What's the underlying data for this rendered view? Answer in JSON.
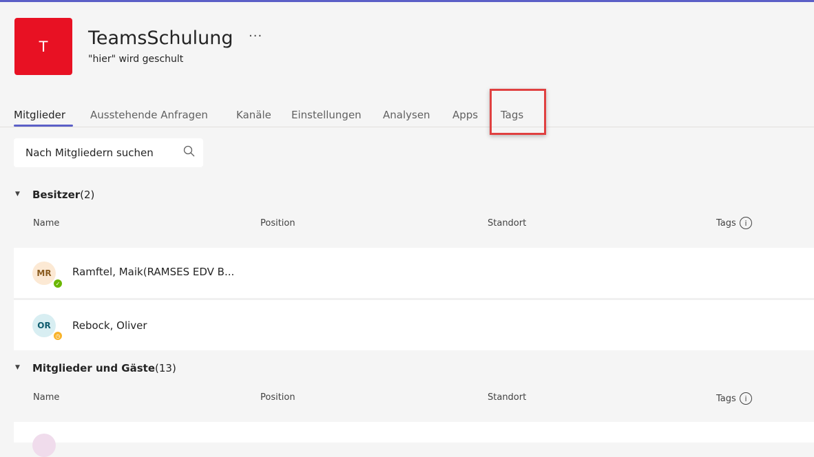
{
  "team": {
    "initial": "T",
    "name": "TeamsSchulung",
    "more": "···",
    "description": "\"hier\" wird geschult",
    "avatar_color": "#e81123"
  },
  "tabs": [
    {
      "label": "Mitglieder",
      "active": true
    },
    {
      "label": "Ausstehende Anfragen",
      "active": false
    },
    {
      "label": "Kanäle",
      "active": false
    },
    {
      "label": "Einstellungen",
      "active": false
    },
    {
      "label": "Analysen",
      "active": false
    },
    {
      "label": "Apps",
      "active": false
    },
    {
      "label": "Tags",
      "active": false,
      "highlighted": true
    }
  ],
  "search": {
    "placeholder": "Nach Mitgliedern suchen",
    "icon": "search-icon"
  },
  "columns": {
    "name": "Name",
    "position": "Position",
    "location": "Standort",
    "tags": "Tags",
    "tags_info": "i"
  },
  "owners": {
    "title": "Besitzer",
    "count": "(2)",
    "members": [
      {
        "initials": "MR",
        "name": "Ramftel, Maik(RAMSES EDV B...",
        "avatar_bg": "#fce9d4",
        "avatar_fg": "#8a5b1e",
        "presence": "available",
        "presence_color": "#6bb700"
      },
      {
        "initials": "OR",
        "name": "Rebock, Oliver",
        "avatar_bg": "#d8eef2",
        "avatar_fg": "#0f5c6e",
        "presence": "away",
        "presence_color": "#f8b32a"
      }
    ]
  },
  "members_guests": {
    "title": "Mitglieder und Gäste",
    "count": "(13)"
  },
  "accent_color": "#5b5fc7",
  "highlight_color": "#e04040"
}
